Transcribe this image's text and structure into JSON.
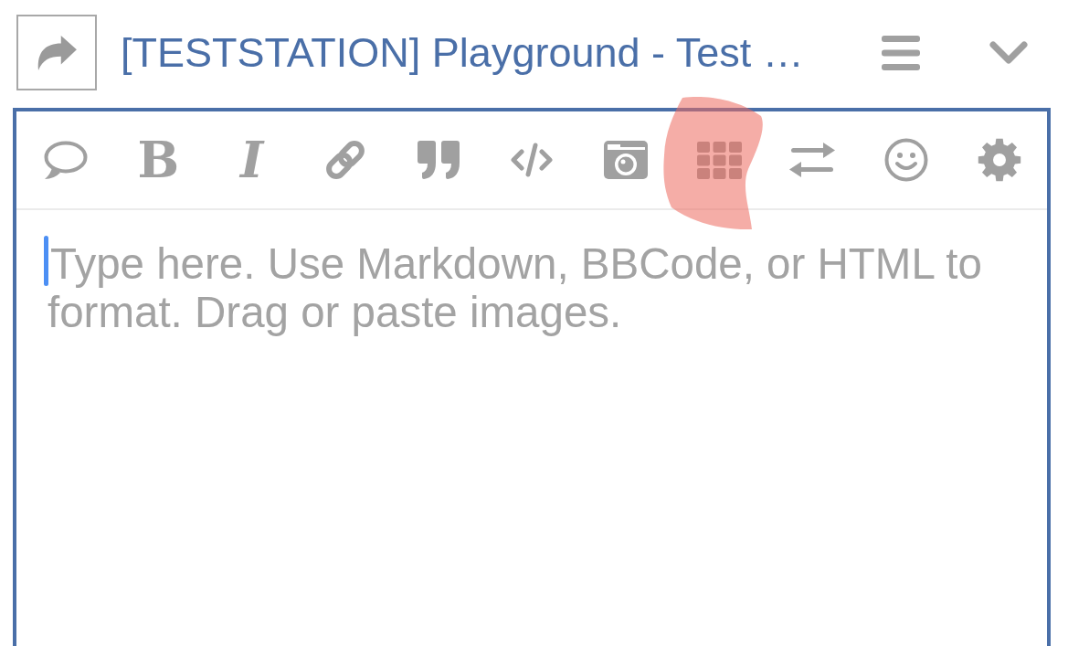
{
  "header": {
    "title": "[TESTSTATION] Playground - Test …"
  },
  "editor": {
    "focused": true,
    "toolbar": [
      {
        "kind": "comment",
        "highlighted": false
      },
      {
        "kind": "bold",
        "label": "B",
        "highlighted": false
      },
      {
        "kind": "italic",
        "label": "I",
        "highlighted": false
      },
      {
        "kind": "link",
        "highlighted": false
      },
      {
        "kind": "quote",
        "highlighted": false
      },
      {
        "kind": "code",
        "highlighted": false
      },
      {
        "kind": "upload",
        "highlighted": false
      },
      {
        "kind": "table",
        "highlighted": true
      },
      {
        "kind": "swap",
        "highlighted": false
      },
      {
        "kind": "emoji",
        "highlighted": false
      },
      {
        "kind": "options",
        "highlighted": false
      }
    ],
    "placeholder": "Type here. Use Markdown, BBCode, or HTML to format. Drag or paste images."
  }
}
